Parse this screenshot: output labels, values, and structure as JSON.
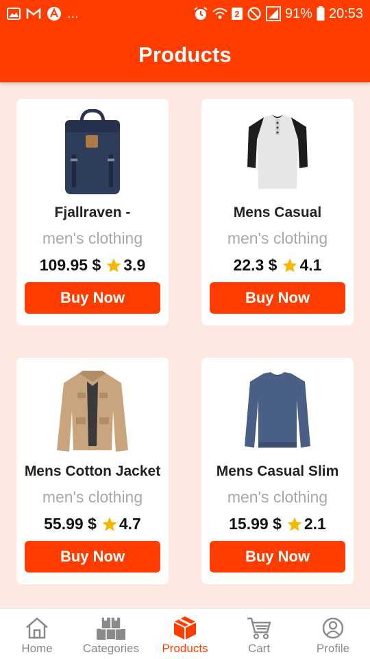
{
  "status_bar": {
    "battery": "91%",
    "time": "20:53",
    "notification_count": "2",
    "dots": "..."
  },
  "header": {
    "title": "Products"
  },
  "products": [
    {
      "title": "Fjallraven -",
      "category": "men's clothing",
      "price": "109.95 $",
      "rating": "3.9",
      "button": "Buy Now",
      "image_icon": "backpack-image"
    },
    {
      "title": "Mens Casual",
      "category": "men's clothing",
      "price": "22.3 $",
      "rating": "4.1",
      "button": "Buy Now",
      "image_icon": "shirt-image"
    },
    {
      "title": "Mens Cotton Jacket",
      "category": "men's clothing",
      "price": "55.99 $",
      "rating": "4.7",
      "button": "Buy Now",
      "image_icon": "jacket-image"
    },
    {
      "title": "Mens Casual Slim",
      "category": "men's clothing",
      "price": "15.99 $",
      "rating": "2.1",
      "button": "Buy Now",
      "image_icon": "sweater-image"
    }
  ],
  "bottom_nav": [
    {
      "label": "Home",
      "icon": "home-icon",
      "active": false
    },
    {
      "label": "Categories",
      "icon": "boxes-icon",
      "active": false
    },
    {
      "label": "Products",
      "icon": "box-icon",
      "active": true
    },
    {
      "label": "Cart",
      "icon": "cart-icon",
      "active": false
    },
    {
      "label": "Profile",
      "icon": "profile-icon",
      "active": false
    }
  ],
  "colors": {
    "primary": "#ff3d00",
    "background": "#fde9e1",
    "star": "#f5b800",
    "muted_text": "#a8a8a8"
  }
}
